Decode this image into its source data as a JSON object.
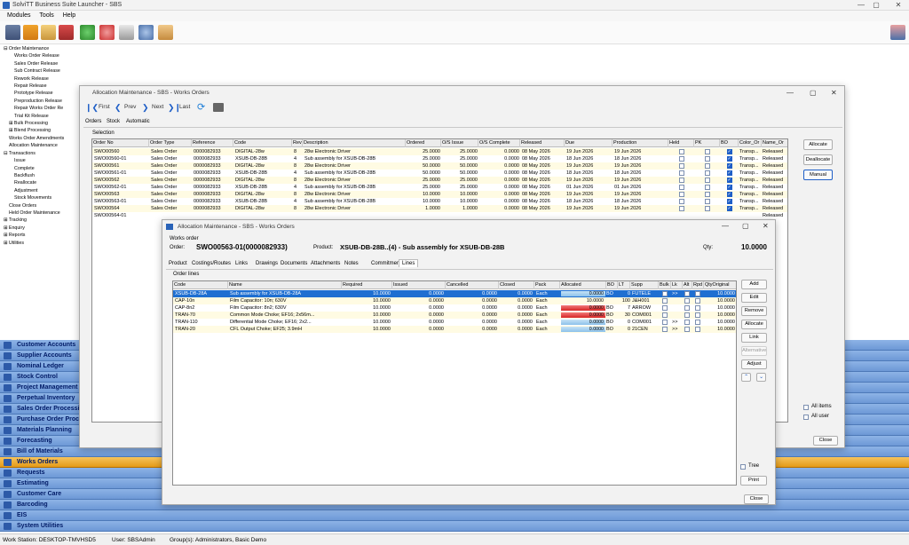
{
  "app": {
    "title": "SolviTT Business Suite Launcher - SBS",
    "menu": [
      "Modules",
      "Tools",
      "Help"
    ],
    "win_controls": [
      "—",
      "▢",
      "✕"
    ]
  },
  "tree": [
    "⊟ Order Maintenance",
    "Works Order Release",
    "Sales Order Release",
    "Sub Contract Release",
    "Rework Release",
    "Repair Release",
    "Prototype Release",
    "Preproduction Release",
    "Repair Works Order Re",
    "Trial Kit Release",
    "⊞ Bulk Processing",
    "⊞ Blend Processing",
    "Works Order Amendments",
    "Allocation Maintenance",
    "⊟ Transactions",
    "Issue",
    "Complete",
    "Backflush",
    "Reallocate",
    "Adjustment",
    "Stock Movements",
    "Close Orders",
    "Held Order Maintenance",
    "⊞ Tracking",
    "⊞ Enquiry",
    "⊞ Reports",
    "⊞ Utilities"
  ],
  "modules": [
    {
      "label": "Customer Accounts",
      "selected": false
    },
    {
      "label": "Supplier Accounts",
      "selected": false
    },
    {
      "label": "Nominal Ledger",
      "selected": false
    },
    {
      "label": "Stock Control",
      "selected": false
    },
    {
      "label": "Project Management",
      "selected": false
    },
    {
      "label": "Perpetual Inventory",
      "selected": false
    },
    {
      "label": "Sales Order Processing",
      "selected": false
    },
    {
      "label": "Purchase Order Processing",
      "selected": false
    },
    {
      "label": "Materials Planning",
      "selected": false
    },
    {
      "label": "Forecasting",
      "selected": false
    },
    {
      "label": "Bill of Materials",
      "selected": false
    },
    {
      "label": "Works Orders",
      "selected": true
    },
    {
      "label": "Requests",
      "selected": false
    },
    {
      "label": "Estimating",
      "selected": false
    },
    {
      "label": "Customer Care",
      "selected": false
    },
    {
      "label": "Barcoding",
      "selected": false
    },
    {
      "label": "EIS",
      "selected": false
    },
    {
      "label": "System Utilities",
      "selected": false
    }
  ],
  "status": {
    "workstation": "Work Station: DESKTOP-TMVHSD5",
    "user": "User: SBSAdmin",
    "groups": "Group(s): Administrators, Basic Demo"
  },
  "alloc_window": {
    "title": "Allocation Maintenance - SBS - Works Orders",
    "nav": {
      "first": "First",
      "prev": "Prev",
      "next": "Next",
      "last": "Last"
    },
    "tabs": [
      "Orders",
      "Stock",
      "Automatic"
    ],
    "selection_label": "Selection",
    "columns": [
      "Order No",
      "Order Type",
      "Reference",
      "Code",
      "Rev",
      "Description",
      "Ordered",
      "O/S Issue",
      "O/S Complete",
      "Released",
      "Due",
      "Production",
      "Held",
      "PK",
      "BO",
      "Color_Or",
      "Name_Or"
    ],
    "rows": [
      {
        "order": "SWO00560",
        "type": "Sales Order",
        "ref": "0000082933",
        "code": "DIGITAL-28w",
        "rev": "8",
        "desc": "28w Electronic Driver",
        "ordered": "25.0000",
        "osi": "25.0000",
        "osc": "0.0000",
        "released": "08 May 2026",
        "due": "19 Jun 2026",
        "prod": "19 Jun 2026",
        "held": false,
        "pk": false,
        "bo": true,
        "color": "Transp...",
        "name": "Released"
      },
      {
        "order": "SWO00560-01",
        "type": "Sales Order",
        "ref": "0000082933",
        "code": "XSUB-DB-28B",
        "rev": "4",
        "desc": "Sub assembly for XSUB-DB-28B",
        "ordered": "25.0000",
        "osi": "25.0000",
        "osc": "0.0000",
        "released": "08 May 2026",
        "due": "18 Jun 2026",
        "prod": "18 Jun 2026",
        "held": false,
        "pk": false,
        "bo": true,
        "color": "Transp...",
        "name": "Released"
      },
      {
        "order": "SWO00561",
        "type": "Sales Order",
        "ref": "0000082933",
        "code": "DIGITAL-28w",
        "rev": "8",
        "desc": "28w Electronic Driver",
        "ordered": "50.0000",
        "osi": "50.0000",
        "osc": "0.0000",
        "released": "08 May 2026",
        "due": "19 Jun 2026",
        "prod": "19 Jun 2026",
        "held": false,
        "pk": false,
        "bo": true,
        "color": "Transp...",
        "name": "Released"
      },
      {
        "order": "SWO00561-01",
        "type": "Sales Order",
        "ref": "0000082933",
        "code": "XSUB-DB-28B",
        "rev": "4",
        "desc": "Sub assembly for XSUB-DB-28B",
        "ordered": "50.0000",
        "osi": "50.0000",
        "osc": "0.0000",
        "released": "08 May 2026",
        "due": "18 Jun 2026",
        "prod": "18 Jun 2026",
        "held": false,
        "pk": false,
        "bo": true,
        "color": "Transp...",
        "name": "Released"
      },
      {
        "order": "SWO00562",
        "type": "Sales Order",
        "ref": "0000082933",
        "code": "DIGITAL-28w",
        "rev": "8",
        "desc": "28w Electronic Driver",
        "ordered": "25.0000",
        "osi": "25.0000",
        "osc": "0.0000",
        "released": "08 May 2026",
        "due": "19 Jun 2026",
        "prod": "19 Jun 2026",
        "held": false,
        "pk": false,
        "bo": true,
        "color": "Transp...",
        "name": "Released"
      },
      {
        "order": "SWO00562-01",
        "type": "Sales Order",
        "ref": "0000082933",
        "code": "XSUB-DB-28B",
        "rev": "4",
        "desc": "Sub assembly for XSUB-DB-28B",
        "ordered": "25.0000",
        "osi": "25.0000",
        "osc": "0.0000",
        "released": "08 May 2026",
        "due": "01 Jun 2026",
        "prod": "01 Jun 2026",
        "held": false,
        "pk": false,
        "bo": true,
        "color": "Transp...",
        "name": "Released"
      },
      {
        "order": "SWO00563",
        "type": "Sales Order",
        "ref": "0000082933",
        "code": "DIGITAL-28w",
        "rev": "8",
        "desc": "28w Electronic Driver",
        "ordered": "10.0000",
        "osi": "10.0000",
        "osc": "0.0000",
        "released": "08 May 2026",
        "due": "19 Jun 2026",
        "prod": "19 Jun 2026",
        "held": false,
        "pk": false,
        "bo": true,
        "color": "Transp...",
        "name": "Released"
      },
      {
        "order": "SWO00563-01",
        "type": "Sales Order",
        "ref": "0000082933",
        "code": "XSUB-DB-28B",
        "rev": "4",
        "desc": "Sub assembly for XSUB-DB-28B",
        "ordered": "10.0000",
        "osi": "10.0000",
        "osc": "0.0000",
        "released": "08 May 2026",
        "due": "18 Jun 2026",
        "prod": "18 Jun 2026",
        "held": false,
        "pk": false,
        "bo": true,
        "color": "Transp...",
        "name": "Released"
      },
      {
        "order": "SWO00564",
        "type": "Sales Order",
        "ref": "0000082933",
        "code": "DIGITAL-28w",
        "rev": "8",
        "desc": "28w Electronic Driver",
        "ordered": "1.0000",
        "osi": "1.0000",
        "osc": "0.0000",
        "released": "08 May 2026",
        "due": "19 Jun 2026",
        "prod": "19 Jun 2026",
        "held": false,
        "pk": false,
        "bo": true,
        "color": "Transp...",
        "name": "Released"
      },
      {
        "order": "SWO00564-01",
        "type": "",
        "ref": "",
        "code": "",
        "rev": "",
        "desc": "",
        "ordered": "",
        "osi": "",
        "osc": "",
        "released": "",
        "due": "",
        "prod": "",
        "held": null,
        "pk": null,
        "bo": null,
        "color": "",
        "name": "Released"
      }
    ],
    "buttons": {
      "allocate": "Allocate",
      "deallocate": "Deallocate",
      "manual": "Manual",
      "close": "Close"
    },
    "options": {
      "all_items": "All items",
      "all_user": "All user"
    }
  },
  "wo_window": {
    "title": "Allocation Maintenance - SBS - Works Orders",
    "section": "Works order",
    "order_label": "Order:",
    "order_value": "SWO00563-01(0000082933)",
    "product_label": "Product:",
    "product_value": "XSUB-DB-28B..(4) - Sub assembly for XSUB-DB-28B",
    "qty_label": "Qty:",
    "qty_value": "10.0000",
    "tabs": [
      "Product",
      "Costings/Routes",
      "Links",
      "Drawings",
      "Documents",
      "Attachments",
      "Notes",
      "Commitment",
      "Lines"
    ],
    "active_tab": "Lines",
    "order_lines_label": "Order lines",
    "columns": [
      "Code",
      "Name",
      "Required",
      "Issued",
      "Cancelled",
      "Closed",
      "Pack",
      "Allocated",
      "BO",
      "LT",
      "Supp",
      "Bulk",
      "Lk",
      "Alt",
      "Rpd",
      "QtyOriginal"
    ],
    "rows": [
      {
        "code": "XSUB-DB-28A",
        "name": "Sub assembly for XSUB-DB-28A",
        "required": "10.0000",
        "issued": "0.0000",
        "cancelled": "0.0000",
        "closed": "0.0000",
        "pack": "Each",
        "allocated": "0.0000",
        "bo": "BO",
        "alloc_state": "blue",
        "lt": "0",
        "supp": "FUTELE",
        "lk": ">>",
        "qtyorig": "10.0000",
        "selected": true
      },
      {
        "code": "CAP-10n",
        "name": "Film Capacitor: 10n; 630V",
        "required": "10.0000",
        "issued": "0.0000",
        "cancelled": "0.0000",
        "closed": "0.0000",
        "pack": "Each",
        "allocated": "10.0000",
        "bo": "",
        "alloc_state": "none",
        "lt": "100",
        "supp": "J&H001",
        "lk": "",
        "qtyorig": "10.0000",
        "selected": false
      },
      {
        "code": "CAP-8n2",
        "name": "Film Capacitor: 8n2; 630V",
        "required": "10.0000",
        "issued": "0.0000",
        "cancelled": "0.0000",
        "closed": "0.0000",
        "pack": "Each",
        "allocated": "0.0000",
        "bo": "BO",
        "alloc_state": "red",
        "lt": "7",
        "supp": "ARROW",
        "lk": "",
        "qtyorig": "10.0000",
        "selected": false
      },
      {
        "code": "TRAN-70",
        "name": "Common Mode Choke; EF16; 2x56m...",
        "required": "10.0000",
        "issued": "0.0000",
        "cancelled": "0.0000",
        "closed": "0.0000",
        "pack": "Each",
        "allocated": "0.0000",
        "bo": "BO",
        "alloc_state": "red",
        "lt": "30",
        "supp": "COM001",
        "lk": "",
        "qtyorig": "10.0000",
        "selected": false
      },
      {
        "code": "TRAN-110",
        "name": "Differential Mode Choke; EF16; 2x2...",
        "required": "10.0000",
        "issued": "0.0000",
        "cancelled": "0.0000",
        "closed": "0.0000",
        "pack": "Each",
        "allocated": "0.0000",
        "bo": "BO",
        "alloc_state": "blue",
        "lt": "0",
        "supp": "COM001",
        "lk": ">>",
        "qtyorig": "10.0000",
        "selected": false
      },
      {
        "code": "TRAN-20",
        "name": "CFL Output Choke; EF25; 3.9mH",
        "required": "10.0000",
        "issued": "0.0000",
        "cancelled": "0.0000",
        "closed": "0.0000",
        "pack": "Each",
        "allocated": "0.0000",
        "bo": "BO",
        "alloc_state": "blue",
        "lt": "0",
        "supp": "21CEN",
        "lk": ">>",
        "qtyorig": "10.0000",
        "selected": false
      }
    ],
    "buttons": {
      "add": "Add",
      "edit": "Edit",
      "remove": "Remove",
      "allocate": "Allocate",
      "link": "Link",
      "alternative": "Alternative",
      "adjust": "Adjust",
      "print": "Print",
      "close": "Close"
    },
    "tree_label": "Tree"
  },
  "colors": {
    "accent": "#1f5fc7",
    "alloc_blue": "#a9d2ef",
    "alloc_red": "#e43a3a",
    "module_bar": "#7aa3dc",
    "module_selected": "#f0b03a"
  }
}
